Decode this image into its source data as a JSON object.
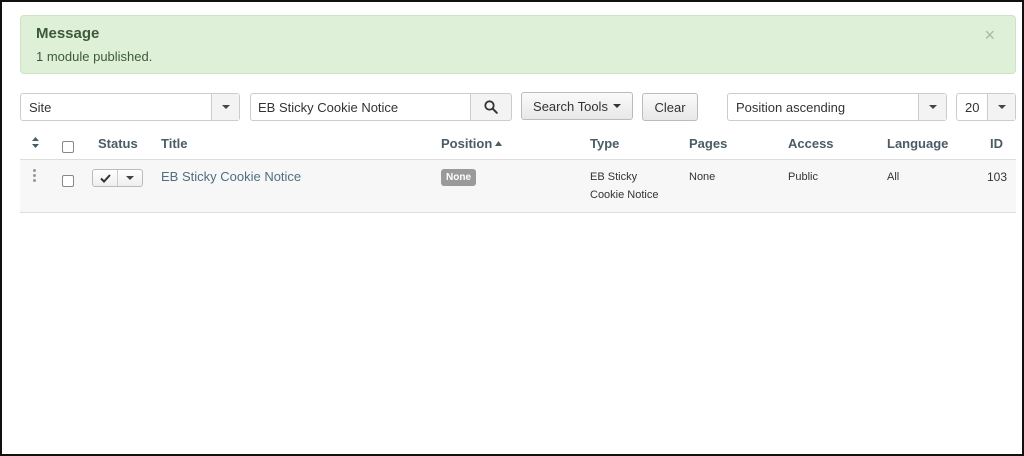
{
  "alert": {
    "heading": "Message",
    "body": "1 module published.",
    "close": "×",
    "bg_color": "#dff0d8"
  },
  "filters": {
    "client": "Site",
    "search": {
      "value": "EB Sticky Cookie Notice",
      "icon": "search-icon"
    },
    "search_tools_label": "Search Tools",
    "clear_label": "Clear",
    "ordering": "Position ascending",
    "limit": "20"
  },
  "table": {
    "headers": {
      "ordering": "sort-icon",
      "status": "Status",
      "title": "Title",
      "position": "Position",
      "type": "Type",
      "pages": "Pages",
      "access": "Access",
      "language": "Language",
      "id": "ID"
    },
    "rows": [
      {
        "status": "published",
        "title": "EB Sticky Cookie Notice",
        "position": "None",
        "type_line1": "EB Sticky",
        "type_line2": "Cookie Notice",
        "pages": "None",
        "access": "Public",
        "language": "All",
        "id": "103"
      }
    ]
  },
  "colors": {
    "link": "#4f6f80",
    "badge": "#9a9a9a",
    "header_text": "#4a5c66"
  }
}
